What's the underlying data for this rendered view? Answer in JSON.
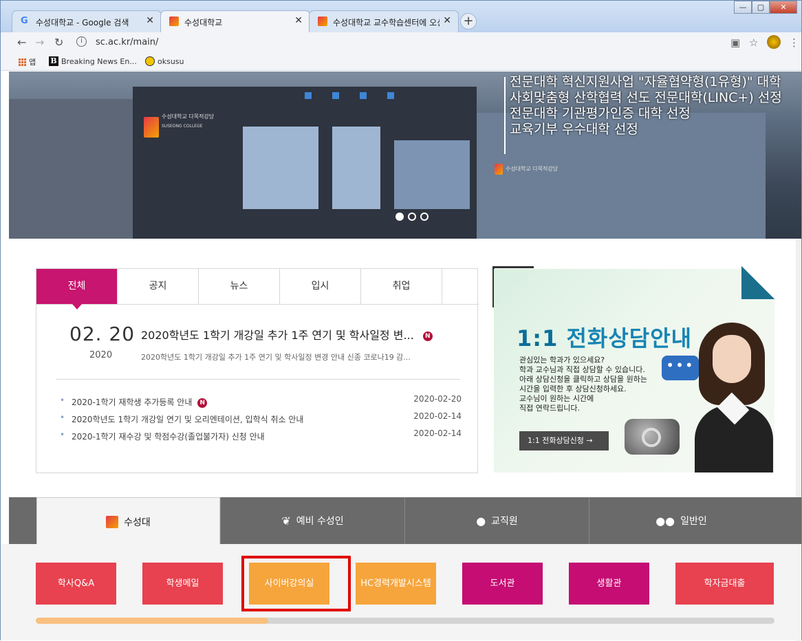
{
  "browser": {
    "tabs": [
      {
        "title": "수성대학교 - Google 검색"
      },
      {
        "title": "수성대학교"
      },
      {
        "title": "수성대학교 교수학습센터에 오신"
      }
    ],
    "url": "sc.ac.kr/main/",
    "bookmarks": {
      "apps": "앱",
      "items": [
        "Breaking News En...",
        "oksusu"
      ]
    }
  },
  "hero": {
    "lines": [
      "전문대학 혁신지원사업 \"자율협약형(1유형)\" 대학",
      "사회맞춤형 산학협력 선도 전문대학(LINC+) 선정",
      "전문대학 기관평가인증 대학 선정",
      "교육기부 우수대학 선정"
    ],
    "building_sign": "수성대학교 다목적강당",
    "building_sign_en": "SUSEONG COLLEGE",
    "slide_active_index": 1,
    "slide_count": 3
  },
  "news": {
    "tabs": [
      "전체",
      "공지",
      "뉴스",
      "입시",
      "취업"
    ],
    "featured": {
      "date": "02. 20",
      "year": "2020",
      "title": "2020학년도 1학기 개강일 추가 1주 연기 및 학사일정 변...",
      "summary": "2020학년도 1학기 개강일 추가 1주 연기 및 학사일정 변경 안내  신종 코로나19 감..."
    },
    "items": [
      {
        "title": "2020-1학기 재학생 추가등록 안내",
        "date": "2020-02-20",
        "is_new": true
      },
      {
        "title": "2020학년도 1학기 개강일 연기 및 오리엔테이션, 입학식 취소 안내",
        "date": "2020-02-14",
        "is_new": false
      },
      {
        "title": "2020-1학기 재수강 및 학점수강(졸업불가자) 신청 안내",
        "date": "2020-02-14",
        "is_new": false
      }
    ],
    "new_badge": "N"
  },
  "banner": {
    "title_num": "1:1",
    "title": "전화상담안내",
    "lines": [
      "관심있는 학과가 있으세요?",
      "학과 교수님과 직접 상담할 수 있습니다.",
      "아래 상담신청을 클릭하고 상담을 원하는",
      "시간을 입력한 후 상담신청하세요.",
      "교수님이 원하는 시간에",
      "직접 연락드립니다."
    ],
    "button": "1:1 전화상담신청  →"
  },
  "groups": [
    "수성대",
    "예비 수성인",
    "교직원",
    "일반인"
  ],
  "quick_links": [
    {
      "label": "학사Q&A",
      "color": "#e8414f"
    },
    {
      "label": "학생메일",
      "color": "#e8414f"
    },
    {
      "label": "사이버강의실",
      "color": "#f6a53c"
    },
    {
      "label": "HC경력개발시스템",
      "color": "#f6a53c"
    },
    {
      "label": "도서관",
      "color": "#c50d73"
    },
    {
      "label": "생활관",
      "color": "#c50d73"
    },
    {
      "label": "학자금대출",
      "color": "#e8414f"
    }
  ],
  "progress_fraction": 0.315,
  "colors": {
    "accent": "#c8156f",
    "highlight": "#e00000"
  }
}
